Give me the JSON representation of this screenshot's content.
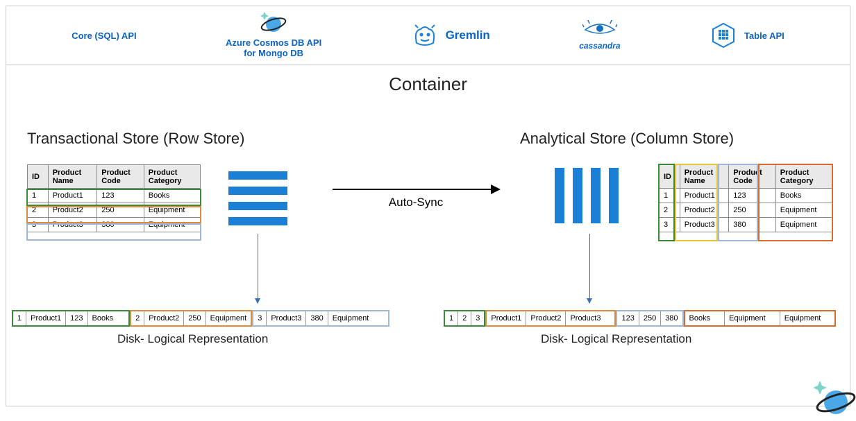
{
  "apis": {
    "core": "Core (SQL) API",
    "mongo": "Azure Cosmos DB API\nfor Mongo DB",
    "gremlin": "Gremlin",
    "cassandra": "cassandra",
    "table": "Table API"
  },
  "container_title": "Container",
  "tx_title": "Transactional Store (Row Store)",
  "an_title": "Analytical Store (Column Store)",
  "headers": {
    "id": "ID",
    "name": "Product\nName",
    "code": "Product\nCode",
    "cat": "Product\nCategory"
  },
  "rows": [
    {
      "id": "1",
      "name": "Product1",
      "code": "123",
      "cat": "Books"
    },
    {
      "id": "2",
      "name": "Product2",
      "code": "250",
      "cat": "Equipment"
    },
    {
      "id": "3",
      "name": "Product3",
      "code": "380",
      "cat": "Equipment"
    }
  ],
  "sync_label": "Auto-Sync",
  "disk_label": "Disk- Logical Representation",
  "colors": {
    "green": "#3a8a3a",
    "orange": "#e08a3c",
    "blue": "#9db8db",
    "yellow": "#e8c53a",
    "dorange": "#d86a2a",
    "bar": "#1b7fd6"
  }
}
